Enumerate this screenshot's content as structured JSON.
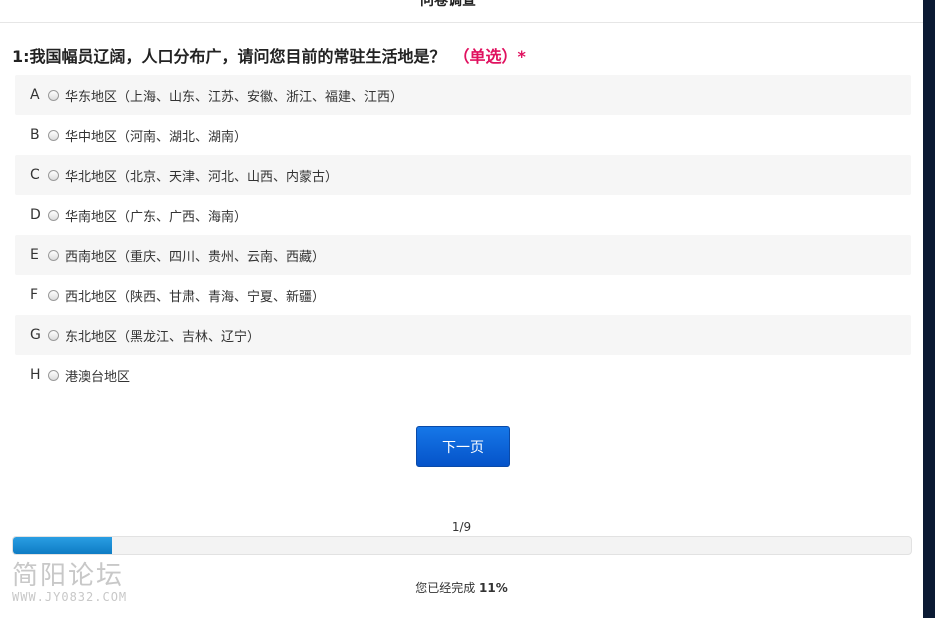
{
  "header": {
    "title": "问卷调查"
  },
  "question": {
    "text": "1:我国幅员辽阔，人口分布广，请问您目前的常驻生活地是？",
    "type_label": "（单选）*",
    "options": [
      {
        "letter": "A",
        "label": "华东地区（上海、山东、江苏、安徽、浙江、福建、江西）"
      },
      {
        "letter": "B",
        "label": "华中地区（河南、湖北、湖南）"
      },
      {
        "letter": "C",
        "label": "华北地区（北京、天津、河北、山西、内蒙古）"
      },
      {
        "letter": "D",
        "label": "华南地区（广东、广西、海南）"
      },
      {
        "letter": "E",
        "label": "西南地区（重庆、四川、贵州、云南、西藏）"
      },
      {
        "letter": "F",
        "label": "西北地区（陕西、甘肃、青海、宁夏、新疆）"
      },
      {
        "letter": "G",
        "label": "东北地区（黑龙江、吉林、辽宁）"
      },
      {
        "letter": "H",
        "label": "港澳台地区"
      }
    ]
  },
  "nav": {
    "next_label": "下一页"
  },
  "progress": {
    "page_indicator": "1/9",
    "percent": 11,
    "complete_prefix": "您已经完成",
    "complete_value": "11%"
  },
  "watermark": {
    "name": "简阳论坛",
    "url": "WWW.JY0832.COM"
  },
  "colors": {
    "accent": "#0553c9",
    "required": "#e0115f",
    "progress": "#1a8ad4"
  }
}
